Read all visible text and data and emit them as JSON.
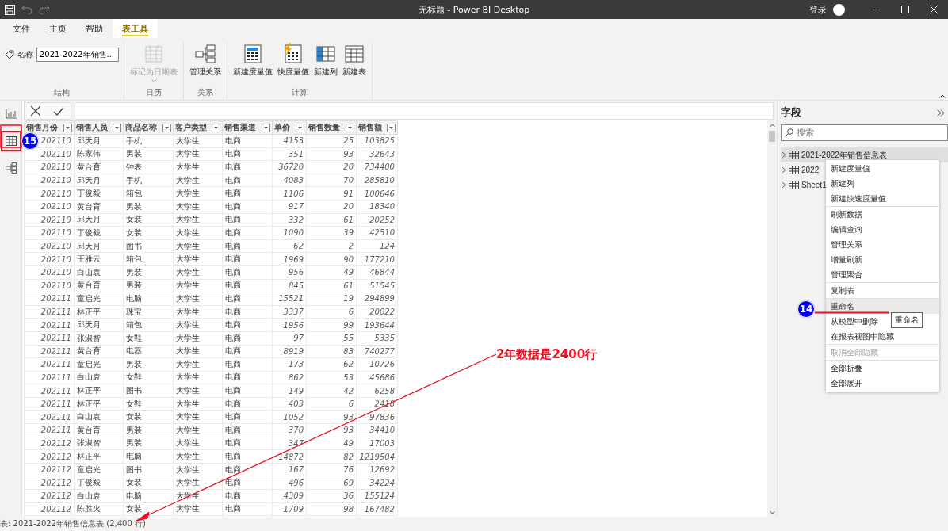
{
  "window": {
    "title": "无标题 - Power BI Desktop",
    "sign_in": "登录"
  },
  "tabs": [
    {
      "label": "文件",
      "selected": false
    },
    {
      "label": "主页",
      "selected": false
    },
    {
      "label": "帮助",
      "selected": false
    },
    {
      "label": "表工具",
      "selected": true
    }
  ],
  "ribbon": {
    "name_label": "名称",
    "name_value": "2021-2022年销售...",
    "groups": [
      {
        "label": "结构"
      },
      {
        "label": "日历",
        "buttons": [
          {
            "label": "标记为日期表",
            "kind": "calendar",
            "disabled": true,
            "dropdown": true
          }
        ]
      },
      {
        "label": "关系",
        "buttons": [
          {
            "label": "管理关系",
            "kind": "relations",
            "disabled": false,
            "dropdown": false
          }
        ]
      },
      {
        "label": "计算",
        "buttons": [
          {
            "label": "新建度量值",
            "kind": "measure",
            "disabled": false,
            "dropdown": false
          },
          {
            "label": "快度量值",
            "kind": "quick",
            "disabled": false,
            "dropdown": false
          },
          {
            "label": "新建列",
            "kind": "column",
            "disabled": false,
            "dropdown": false
          },
          {
            "label": "新建表",
            "kind": "table",
            "disabled": false,
            "dropdown": false
          }
        ]
      }
    ]
  },
  "left_nav": [
    {
      "kind": "report",
      "selected": false
    },
    {
      "kind": "data",
      "selected": true
    },
    {
      "kind": "model",
      "selected": false
    }
  ],
  "table": {
    "columns": [
      "销售月份",
      "销售人员",
      "商品名称",
      "客户类型",
      "销售渠道",
      "单价",
      "销售数量",
      "销售额"
    ],
    "rows": [
      [
        "202110",
        "邱天月",
        "手机",
        "大学生",
        "电商",
        "4153",
        "25",
        "103825"
      ],
      [
        "202110",
        "陈家伟",
        "男装",
        "大学生",
        "电商",
        "351",
        "93",
        "32643"
      ],
      [
        "202110",
        "黄台育",
        "钟表",
        "大学生",
        "电商",
        "36720",
        "20",
        "734400"
      ],
      [
        "202110",
        "邱天月",
        "手机",
        "大学生",
        "电商",
        "4083",
        "70",
        "285810"
      ],
      [
        "202110",
        "丁俊毅",
        "箱包",
        "大学生",
        "电商",
        "1106",
        "91",
        "100646"
      ],
      [
        "202110",
        "黄台育",
        "男装",
        "大学生",
        "电商",
        "917",
        "20",
        "18340"
      ],
      [
        "202110",
        "邱天月",
        "女装",
        "大学生",
        "电商",
        "332",
        "61",
        "20252"
      ],
      [
        "202110",
        "丁俊毅",
        "女装",
        "大学生",
        "电商",
        "1090",
        "39",
        "42510"
      ],
      [
        "202110",
        "邱天月",
        "图书",
        "大学生",
        "电商",
        "62",
        "2",
        "124"
      ],
      [
        "202110",
        "王雅云",
        "箱包",
        "大学生",
        "电商",
        "1969",
        "90",
        "177210"
      ],
      [
        "202110",
        "白山袁",
        "男装",
        "大学生",
        "电商",
        "956",
        "49",
        "46844"
      ],
      [
        "202110",
        "黄台育",
        "男装",
        "大学生",
        "电商",
        "845",
        "61",
        "51545"
      ],
      [
        "202111",
        "童启光",
        "电脑",
        "大学生",
        "电商",
        "15521",
        "19",
        "294899"
      ],
      [
        "202111",
        "林正平",
        "珠宝",
        "大学生",
        "电商",
        "3337",
        "6",
        "20022"
      ],
      [
        "202111",
        "邱天月",
        "箱包",
        "大学生",
        "电商",
        "1956",
        "99",
        "193644"
      ],
      [
        "202111",
        "张淑智",
        "女鞋",
        "大学生",
        "电商",
        "97",
        "55",
        "5335"
      ],
      [
        "202111",
        "黄台育",
        "电器",
        "大学生",
        "电商",
        "8919",
        "83",
        "740277"
      ],
      [
        "202111",
        "童启光",
        "男装",
        "大学生",
        "电商",
        "173",
        "62",
        "10726"
      ],
      [
        "202111",
        "白山袁",
        "女鞋",
        "大学生",
        "电商",
        "862",
        "53",
        "45686"
      ],
      [
        "202111",
        "林正平",
        "图书",
        "大学生",
        "电商",
        "149",
        "42",
        "6258"
      ],
      [
        "202111",
        "林正平",
        "女鞋",
        "大学生",
        "电商",
        "403",
        "6",
        "2418"
      ],
      [
        "202111",
        "白山袁",
        "女装",
        "大学生",
        "电商",
        "1052",
        "93",
        "97836"
      ],
      [
        "202111",
        "黄台育",
        "男装",
        "大学生",
        "电商",
        "370",
        "93",
        "34410"
      ],
      [
        "202112",
        "张淑智",
        "男装",
        "大学生",
        "电商",
        "347",
        "49",
        "17003"
      ],
      [
        "202112",
        "林正平",
        "电脑",
        "大学生",
        "电商",
        "14872",
        "82",
        "1219504"
      ],
      [
        "202112",
        "童启光",
        "图书",
        "大学生",
        "电商",
        "167",
        "76",
        "12692"
      ],
      [
        "202112",
        "丁俊毅",
        "女装",
        "大学生",
        "电商",
        "496",
        "69",
        "34224"
      ],
      [
        "202112",
        "白山袁",
        "电脑",
        "大学生",
        "电商",
        "4309",
        "36",
        "155124"
      ],
      [
        "202112",
        "陈胜火",
        "女装",
        "大学生",
        "电商",
        "1709",
        "98",
        "167482"
      ]
    ]
  },
  "fields": {
    "title": "字段",
    "search": {
      "placeholder": "搜索"
    },
    "tables": [
      {
        "name": "2021-2022年销售信息表",
        "selected": true
      },
      {
        "name": "2022",
        "selected": false
      },
      {
        "name": "Sheet1",
        "selected": false
      }
    ]
  },
  "context_menu": {
    "sections": [
      [
        {
          "label": "新建度量值",
          "disabled": false,
          "selected": false
        },
        {
          "label": "新建列",
          "disabled": false,
          "selected": false
        },
        {
          "label": "新建快速度量值",
          "disabled": false,
          "selected": false
        }
      ],
      [
        {
          "label": "刷新数据",
          "disabled": false,
          "selected": false
        },
        {
          "label": "编辑查询",
          "disabled": false,
          "selected": false
        },
        {
          "label": "管理关系",
          "disabled": false,
          "selected": false
        },
        {
          "label": "增量刷新",
          "disabled": false,
          "selected": false
        },
        {
          "label": "管理聚合",
          "disabled": false,
          "selected": false
        }
      ],
      [
        {
          "label": "复制表",
          "disabled": false,
          "selected": false
        }
      ],
      [
        {
          "label": "重命名",
          "disabled": false,
          "selected": true
        },
        {
          "label": "从模型中删除",
          "disabled": false,
          "selected": false
        },
        {
          "label": "在报表视图中隐藏",
          "disabled": false,
          "selected": false
        }
      ],
      [
        {
          "label": "取消全部隐藏",
          "disabled": true,
          "selected": false
        }
      ],
      [
        {
          "label": "全部折叠",
          "disabled": false,
          "selected": false
        },
        {
          "label": "全部展开",
          "disabled": false,
          "selected": false
        }
      ]
    ],
    "tooltip": "重命名"
  },
  "annotations": {
    "badges": [
      "15",
      "14"
    ],
    "note": "2年数据是2400行"
  },
  "status_bar": "表: 2021-2022年销售信息表 (2,400 行)"
}
